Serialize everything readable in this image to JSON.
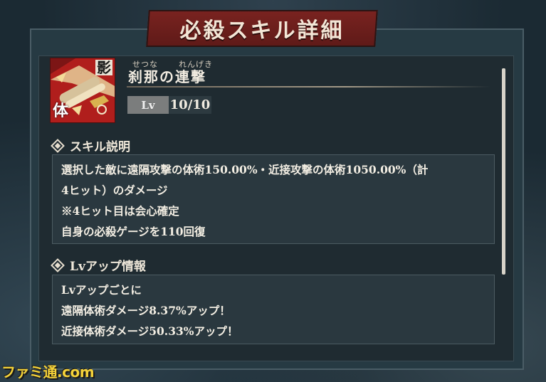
{
  "dialog": {
    "title": "必殺スキル詳細"
  },
  "skill": {
    "icon_name": "skill-portrait-icon",
    "icon_badge": "影",
    "icon_type": "体",
    "furigana_1": "せつな",
    "furigana_2": "れんげき",
    "name": "刹那の連撃",
    "level_label": "Lv",
    "level_value": "10/10"
  },
  "description": {
    "heading": "スキル説明",
    "lines": [
      "選択した敵に遠隔攻撃の体術150.00%・近接攻撃の体術1050.00%（計",
      "4ヒット）のダメージ",
      "※4ヒット目は会心確定",
      "自身の必殺ゲージを110回復"
    ]
  },
  "levelup": {
    "heading": "Lvアップ情報",
    "lines": [
      "Lvアップごとに",
      "遠隔体術ダメージ8.37%アップ！",
      "近接体術ダメージ50.33%アップ！"
    ]
  },
  "watermark": "ファミ通.com",
  "colors": {
    "banner": "#7a2320",
    "panel": "#1f2b31",
    "textbox": "#2a383f",
    "icon_bg": "#b01e1c"
  }
}
